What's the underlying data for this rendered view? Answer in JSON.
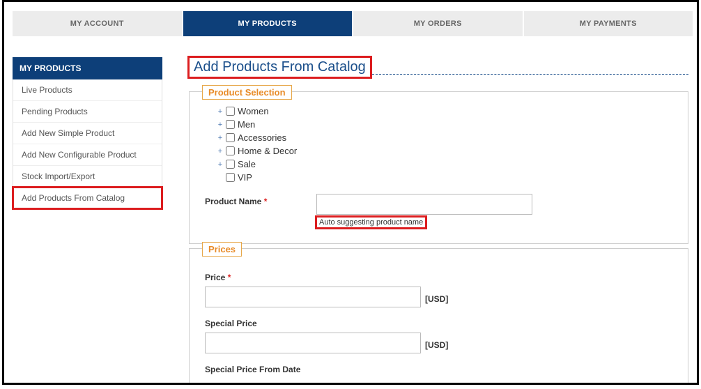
{
  "tabs": {
    "account": "MY ACCOUNT",
    "products": "MY PRODUCTS",
    "orders": "MY ORDERS",
    "payments": "MY PAYMENTS"
  },
  "sidebar": {
    "header": "MY PRODUCTS",
    "items": [
      "Live Products",
      "Pending Products",
      "Add New Simple Product",
      "Add New Configurable Product",
      "Stock Import/Export",
      "Add Products From Catalog"
    ]
  },
  "page": {
    "title": "Add Products From Catalog"
  },
  "sections": {
    "product_selection": {
      "legend": "Product Selection",
      "categories": [
        "Women",
        "Men",
        "Accessories",
        "Home & Decor",
        "Sale",
        "VIP"
      ],
      "name_label": "Product Name",
      "name_hint": "Auto suggesting product name"
    },
    "prices": {
      "legend": "Prices",
      "price_label": "Price",
      "special_price_label": "Special Price",
      "special_price_from_label": "Special Price From Date",
      "currency": "[USD]"
    }
  }
}
